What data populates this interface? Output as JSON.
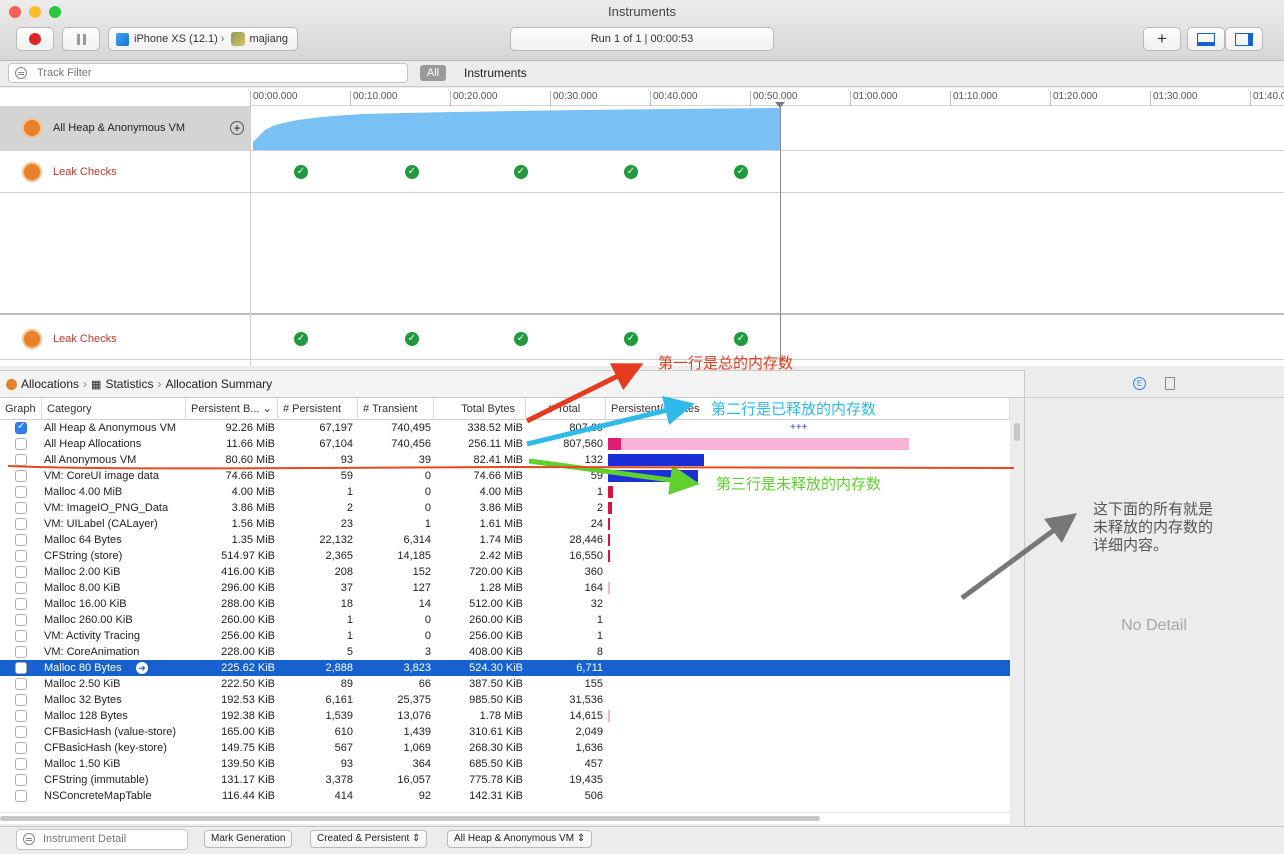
{
  "window": {
    "title": "Instruments",
    "device": "iPhone XS (12.1)",
    "target": "majiang",
    "run_status": "Run 1 of 1  |  00:00:53",
    "add_button": "+"
  },
  "filter": {
    "placeholder": "Track Filter",
    "all_label": "All",
    "instruments_label": "Instruments"
  },
  "ruler": [
    "00:00.000",
    "00:10.000",
    "00:20.000",
    "00:30.000",
    "00:40.000",
    "00:50.000",
    "01:00.000",
    "01:10.000",
    "01:20.000",
    "01:30.000",
    "01:40.0"
  ],
  "tracks": [
    {
      "label": "All Heap & Anonymous VM"
    },
    {
      "label": "Leak Checks"
    },
    {
      "label": "Leak Checks"
    }
  ],
  "jumpbar": {
    "allocations": "Allocations",
    "statistics": "Statistics",
    "summary": "Allocation Summary"
  },
  "table": {
    "headers": [
      "Graph",
      "Category",
      "Persistent B...",
      "# Persistent",
      "# Transient",
      "Total Bytes",
      "# Total",
      "Persistent/# Bytes"
    ],
    "rows": [
      {
        "category": "All Heap & Anonymous VM",
        "pb": "92.26 MiB",
        "np": "67,197",
        "nt": "740,495",
        "tb": "338.52 MiB",
        "ntot": "807,69",
        "checked": true,
        "hist": 0,
        "marker": "+++"
      },
      {
        "category": "All Heap Allocations",
        "pb": "11.66 MiB",
        "np": "67,104",
        "nt": "740,456",
        "tb": "256.11 MiB",
        "ntot": "807,560",
        "checked": false,
        "hist": 0.97
      },
      {
        "category": "All Anonymous VM",
        "pb": "80.60 MiB",
        "np": "93",
        "nt": "39",
        "tb": "82.41 MiB",
        "ntot": "132",
        "checked": false,
        "hist": 0.31
      },
      {
        "category": "VM: CoreUI image data",
        "pb": "74.66 MiB",
        "np": "59",
        "nt": "0",
        "tb": "74.66 MiB",
        "ntot": "59",
        "checked": false,
        "hist": 0.29
      },
      {
        "category": "Malloc 4.00 MiB",
        "pb": "4.00 MiB",
        "np": "1",
        "nt": "0",
        "tb": "4.00 MiB",
        "ntot": "1",
        "checked": false,
        "hist": 0.015
      },
      {
        "category": "VM: ImageIO_PNG_Data",
        "pb": "3.86 MiB",
        "np": "2",
        "nt": "0",
        "tb": "3.86 MiB",
        "ntot": "2",
        "checked": false,
        "hist": 0.014
      },
      {
        "category": "VM: UILabel (CALayer)",
        "pb": "1.56 MiB",
        "np": "23",
        "nt": "1",
        "tb": "1.61 MiB",
        "ntot": "24",
        "checked": false,
        "hist": 0.008
      },
      {
        "category": "Malloc 64 Bytes",
        "pb": "1.35 MiB",
        "np": "22,132",
        "nt": "6,314",
        "tb": "1.74 MiB",
        "ntot": "28,446",
        "checked": false,
        "hist": 0.007
      },
      {
        "category": "CFString (store)",
        "pb": "514.97 KiB",
        "np": "2,365",
        "nt": "14,185",
        "tb": "2.42 MiB",
        "ntot": "16,550",
        "checked": false,
        "hist": 0.004
      },
      {
        "category": "Malloc 2.00 KiB",
        "pb": "416.00 KiB",
        "np": "208",
        "nt": "152",
        "tb": "720.00 KiB",
        "ntot": "360",
        "checked": false,
        "hist": 0
      },
      {
        "category": "Malloc 8.00 KiB",
        "pb": "296.00 KiB",
        "np": "37",
        "nt": "127",
        "tb": "1.28 MiB",
        "ntot": "164",
        "checked": false,
        "hist": 0.003
      },
      {
        "category": "Malloc 16.00 KiB",
        "pb": "288.00 KiB",
        "np": "18",
        "nt": "14",
        "tb": "512.00 KiB",
        "ntot": "32",
        "checked": false,
        "hist": 0
      },
      {
        "category": "Malloc 260.00 KiB",
        "pb": "260.00 KiB",
        "np": "1",
        "nt": "0",
        "tb": "260.00 KiB",
        "ntot": "1",
        "checked": false,
        "hist": 0
      },
      {
        "category": "VM: Activity Tracing",
        "pb": "256.00 KiB",
        "np": "1",
        "nt": "0",
        "tb": "256.00 KiB",
        "ntot": "1",
        "checked": false,
        "hist": 0
      },
      {
        "category": "VM: CoreAnimation",
        "pb": "228.00 KiB",
        "np": "5",
        "nt": "3",
        "tb": "408.00 KiB",
        "ntot": "8",
        "checked": false,
        "hist": 0
      },
      {
        "category": "Malloc 80 Bytes",
        "pb": "225.62 KiB",
        "np": "2,888",
        "nt": "3,823",
        "tb": "524.30 KiB",
        "ntot": "6,711",
        "checked": false,
        "hist": 0,
        "selected": true
      },
      {
        "category": "Malloc 2.50 KiB",
        "pb": "222.50 KiB",
        "np": "89",
        "nt": "66",
        "tb": "387.50 KiB",
        "ntot": "155",
        "checked": false,
        "hist": 0
      },
      {
        "category": "Malloc 32 Bytes",
        "pb": "192.53 KiB",
        "np": "6,161",
        "nt": "25,375",
        "tb": "985.50 KiB",
        "ntot": "31,536",
        "checked": false,
        "hist": 0
      },
      {
        "category": "Malloc 128 Bytes",
        "pb": "192.38 KiB",
        "np": "1,539",
        "nt": "13,076",
        "tb": "1.78 MiB",
        "ntot": "14,615",
        "checked": false,
        "hist": 0.003
      },
      {
        "category": "CFBasicHash (value-store)",
        "pb": "165.00 KiB",
        "np": "610",
        "nt": "1,439",
        "tb": "310.61 KiB",
        "ntot": "2,049",
        "checked": false,
        "hist": 0
      },
      {
        "category": "CFBasicHash (key-store)",
        "pb": "149.75 KiB",
        "np": "567",
        "nt": "1,069",
        "tb": "268.30 KiB",
        "ntot": "1,636",
        "checked": false,
        "hist": 0
      },
      {
        "category": "Malloc 1.50 KiB",
        "pb": "139.50 KiB",
        "np": "93",
        "nt": "364",
        "tb": "685.50 KiB",
        "ntot": "457",
        "checked": false,
        "hist": 0
      },
      {
        "category": "CFString (immutable)",
        "pb": "131.17 KiB",
        "np": "3,378",
        "nt": "16,057",
        "tb": "775.78 KiB",
        "ntot": "19,435",
        "checked": false,
        "hist": 0
      },
      {
        "category": "NSConcreteMapTable",
        "pb": "116.44 KiB",
        "np": "414",
        "nt": "92",
        "tb": "142.31 KiB",
        "ntot": "506",
        "checked": false,
        "hist": 0
      }
    ]
  },
  "inspector": {
    "no_detail": "No Detail"
  },
  "bottom": {
    "detail_placeholder": "Instrument Detail",
    "mark_generation": "Mark Generation",
    "created_persistent": "Created & Persistent",
    "scope": "All Heap & Anonymous VM"
  },
  "annotations": {
    "row1": "第一行是总的内存数",
    "row2": "第二行是已释放的内存数",
    "row3": "第三行是未释放的内存数",
    "below": "这下面的所有就是未释放的内存数的详细内容。"
  },
  "colors": {
    "accent": "#1660cf",
    "heap_graph": "#79c0f5",
    "hist_pink": "#f6b3d6",
    "hist_blue": "#1b2fd8",
    "hist_red": "#d6163f",
    "note_red": "#e33c1f",
    "note_cyan": "#2ebbeb",
    "note_green": "#5fd02e"
  }
}
